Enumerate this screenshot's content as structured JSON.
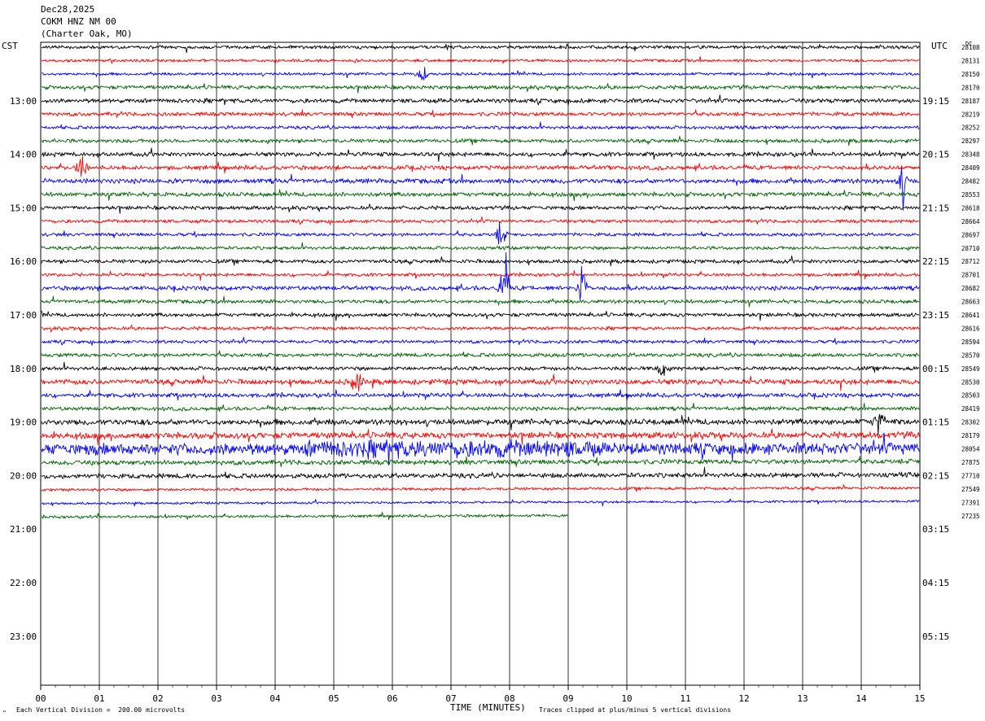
{
  "header": {
    "date": "Dec28,2025",
    "station": "COKM HNZ NM 00",
    "location": "(Charter Oak, MO)"
  },
  "left_axis_title": "CST",
  "right_axis_title": "UTC",
  "dc_title": "DC",
  "footer": {
    "scale_note": "Each Vertical Division =  200.00 microvolts",
    "x_axis_title": "TIME (MINUTES)",
    "clip_note": "Traces clipped at plus/minus 5 vertical divisions",
    "corner_mark": "\""
  },
  "colors": {
    "trace_cycle": [
      "#000000",
      "#ff0000",
      "#0000ff",
      "#006400"
    ],
    "grid": "#000000",
    "background": "#ffffff"
  },
  "chart_data": {
    "type": "line",
    "xlabel": "TIME (MINUTES)",
    "xlim": [
      0,
      15
    ],
    "x_ticks": [
      "00",
      "01",
      "02",
      "03",
      "04",
      "05",
      "06",
      "07",
      "08",
      "09",
      "10",
      "11",
      "12",
      "13",
      "14",
      "15"
    ],
    "rows_total": 48,
    "minutes_per_row": 15,
    "cst_hour_labels": [
      "13:00",
      "14:00",
      "15:00",
      "16:00",
      "17:00",
      "18:00",
      "19:00",
      "20:00",
      "21:00",
      "22:00",
      "23:00"
    ],
    "utc_hour_labels": [
      "19:15",
      "20:15",
      "21:15",
      "22:15",
      "23:15",
      "00:15",
      "01:15",
      "02:15",
      "03:15",
      "04:15",
      "05:15"
    ],
    "dc_offsets": [
      28108,
      28131,
      28150,
      28170,
      28187,
      28219,
      28252,
      28297,
      28348,
      28409,
      28482,
      28553,
      28618,
      28664,
      28697,
      28710,
      28712,
      28701,
      28682,
      28663,
      28641,
      28616,
      28594,
      28570,
      28549,
      28530,
      28503,
      28419,
      28302,
      28179,
      28054,
      27875,
      27710,
      27549,
      27391,
      27235
    ],
    "trace_count": 36,
    "last_trace_end_minute": 9.0,
    "activity_levels": [
      0.7,
      0.6,
      0.6,
      0.8,
      0.9,
      0.8,
      0.7,
      0.8,
      0.9,
      0.9,
      1.0,
      0.9,
      0.8,
      0.7,
      0.7,
      0.7,
      0.8,
      0.7,
      0.9,
      0.8,
      0.8,
      0.7,
      0.7,
      0.8,
      0.8,
      1.1,
      0.9,
      0.8,
      1.2,
      1.3,
      2.4,
      1.0,
      1.0,
      0.6,
      0.5,
      0.6
    ],
    "events": [
      {
        "trace": 2,
        "minute": 6.5,
        "amp": 2.5
      },
      {
        "trace": 9,
        "minute": 0.7,
        "amp": 2.5
      },
      {
        "trace": 10,
        "minute": 14.7,
        "amp": 3
      },
      {
        "trace": 14,
        "minute": 7.85,
        "amp": 3
      },
      {
        "trace": 18,
        "minute": 7.9,
        "amp": 5
      },
      {
        "trace": 18,
        "minute": 9.25,
        "amp": 5
      },
      {
        "trace": 24,
        "minute": 10.6,
        "amp": 2
      },
      {
        "trace": 25,
        "minute": 5.4,
        "amp": 2
      },
      {
        "trace": 28,
        "minute": 14.3,
        "amp": 2.5
      }
    ]
  }
}
